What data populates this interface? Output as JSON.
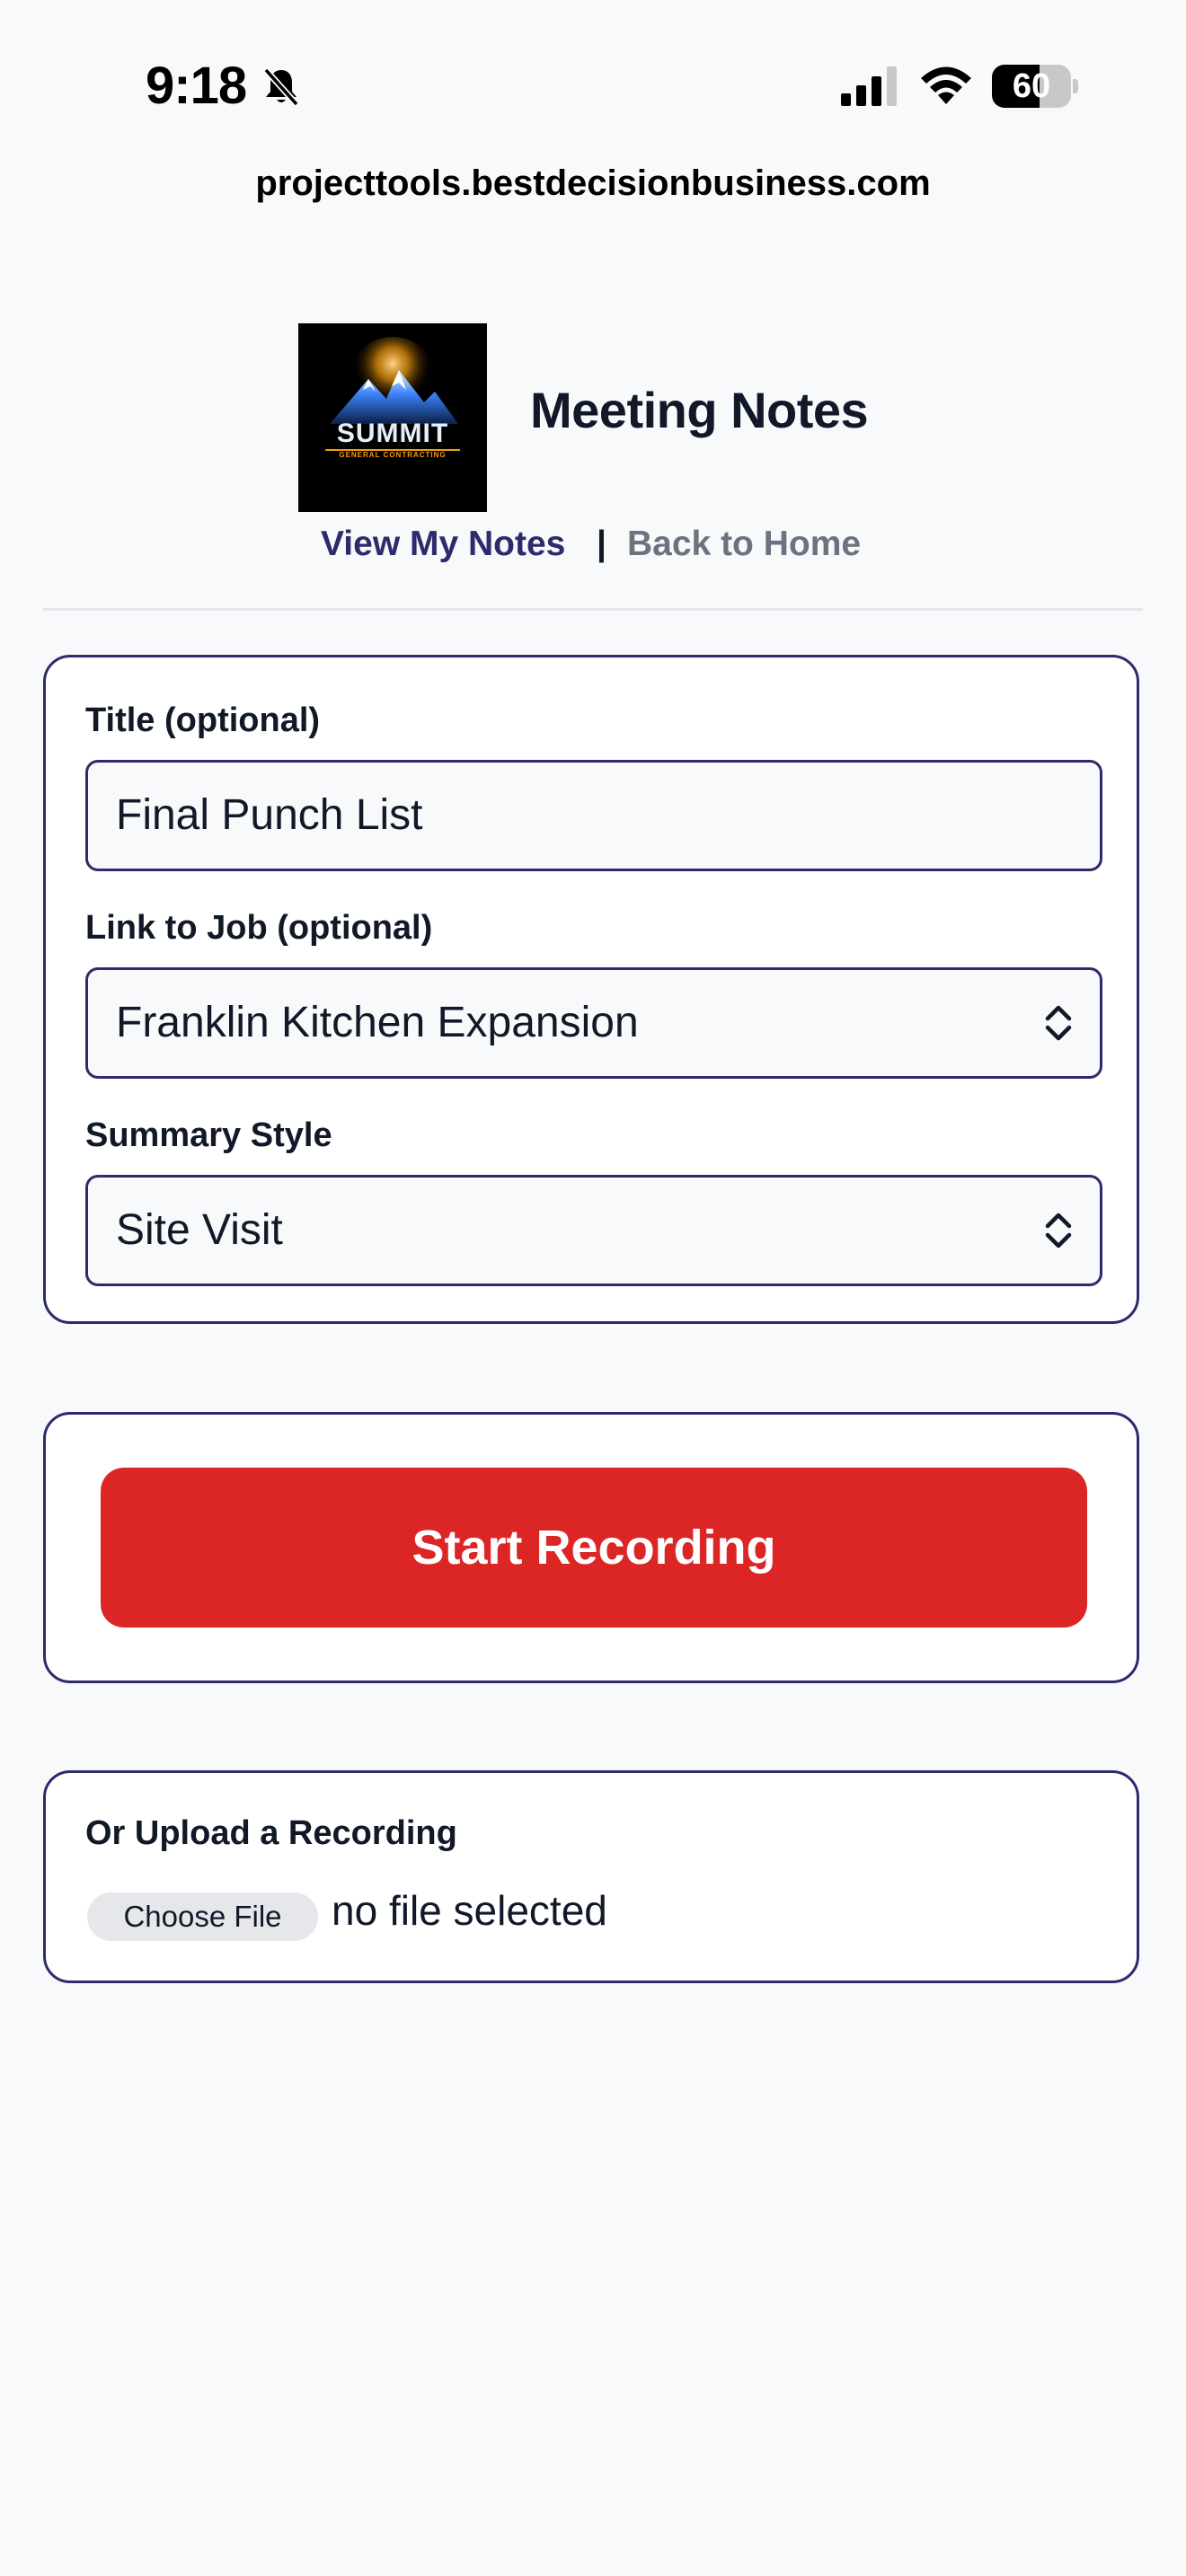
{
  "status_bar": {
    "time": "9:18",
    "battery": "60",
    "battery_level": 0.6,
    "icons": [
      "bell-slash-icon",
      "signal-icon",
      "wifi-icon",
      "battery-icon"
    ]
  },
  "browser": {
    "url": "projecttools.bestdecisionbusiness.com"
  },
  "header": {
    "logo_name": "SUMMIT",
    "logo_tagline": "GENERAL CONTRACTING",
    "title": "Meeting Notes",
    "nav_primary": "View My Notes",
    "nav_separator": "|",
    "nav_secondary": "Back to Home"
  },
  "form": {
    "title_label": "Title (optional)",
    "title_value": "Final Punch List",
    "job_label": "Link to Job (optional)",
    "job_value": "Franklin Kitchen Expansion",
    "style_label": "Summary Style",
    "style_value": "Site Visit"
  },
  "recording": {
    "button_label": "Start Recording"
  },
  "upload": {
    "label": "Or Upload a Recording",
    "choose_label": "Choose File",
    "file_status": "no file selected"
  },
  "colors": {
    "accent": "#2e2a6b",
    "record": "#dc2626",
    "background": "#f8f9fb",
    "muted": "#6b7280"
  }
}
